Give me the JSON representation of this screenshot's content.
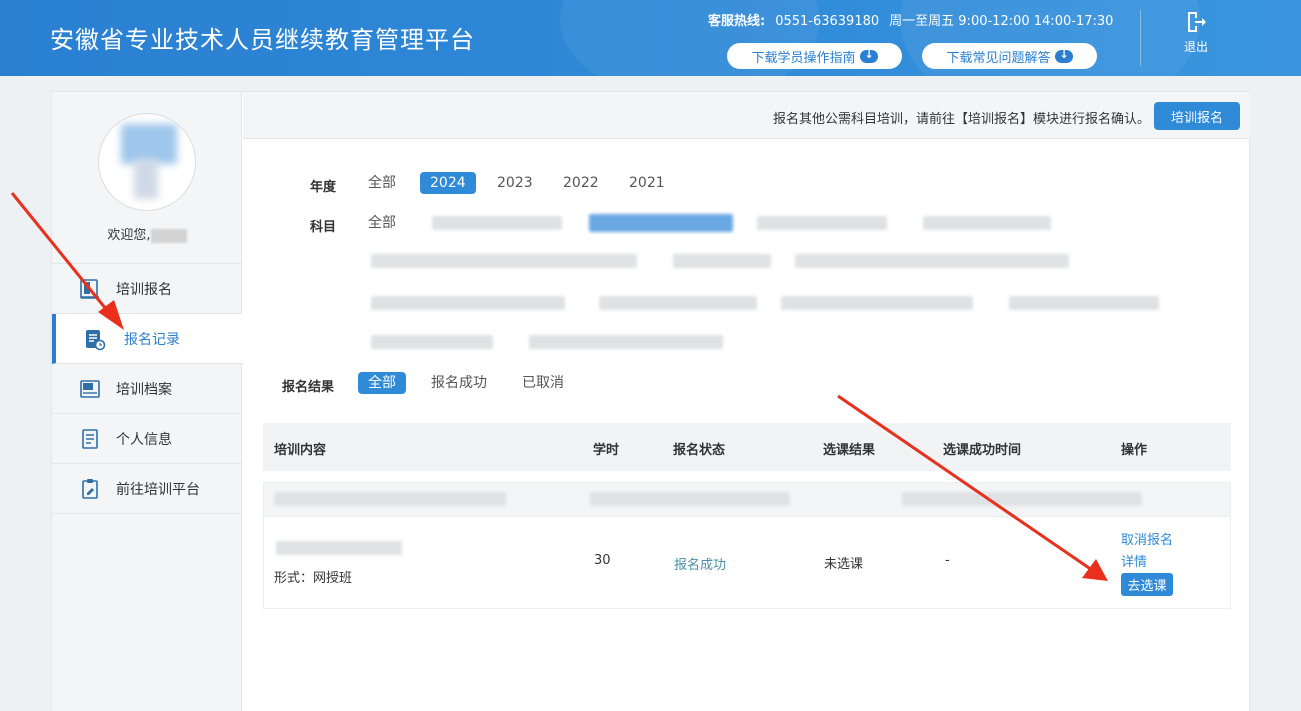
{
  "header": {
    "title": "安徽省专业技术人员继续教育管理平台",
    "hotline_label": "客服热线:",
    "hotline_number": "0551-63639180",
    "hotline_hours": "周一至周五 9:00-12:00 14:00-17:30",
    "download_guide": "下载学员操作指南",
    "download_faq": "下载常见问题解答",
    "logout": "退出"
  },
  "sidebar": {
    "welcome": "欢迎您,",
    "items": [
      {
        "label": "培训报名",
        "icon": "book-icon"
      },
      {
        "label": "报名记录",
        "icon": "record-clock-icon"
      },
      {
        "label": "培训档案",
        "icon": "archive-icon"
      },
      {
        "label": "个人信息",
        "icon": "document-icon"
      },
      {
        "label": "前往培训平台",
        "icon": "clipboard-edit-icon"
      }
    ]
  },
  "notice": {
    "text": "报名其他公需科目培训，请前往【培训报名】模块进行报名确认。",
    "button": "培训报名"
  },
  "filters": {
    "year_label": "年度",
    "years": [
      "全部",
      "2024",
      "2023",
      "2022",
      "2021"
    ],
    "selected_year": "2024",
    "subject_label": "科目",
    "subject_all": "全部",
    "result_label": "报名结果",
    "results": [
      "全部",
      "报名成功",
      "已取消"
    ],
    "selected_result": "全部"
  },
  "table": {
    "headers": [
      "培训内容",
      "学时",
      "报名状态",
      "选课结果",
      "选课成功时间",
      "操作"
    ],
    "row": {
      "form": "形式：网授班",
      "hours": "30",
      "status": "报名成功",
      "result": "未选课",
      "time": "-",
      "actions": {
        "cancel": "取消报名",
        "detail": "详情",
        "choose": "去选课"
      }
    }
  },
  "colors": {
    "primary": "#2f8ad8",
    "header_bg": "#2a7fd1",
    "arrow": "#e8301c"
  }
}
